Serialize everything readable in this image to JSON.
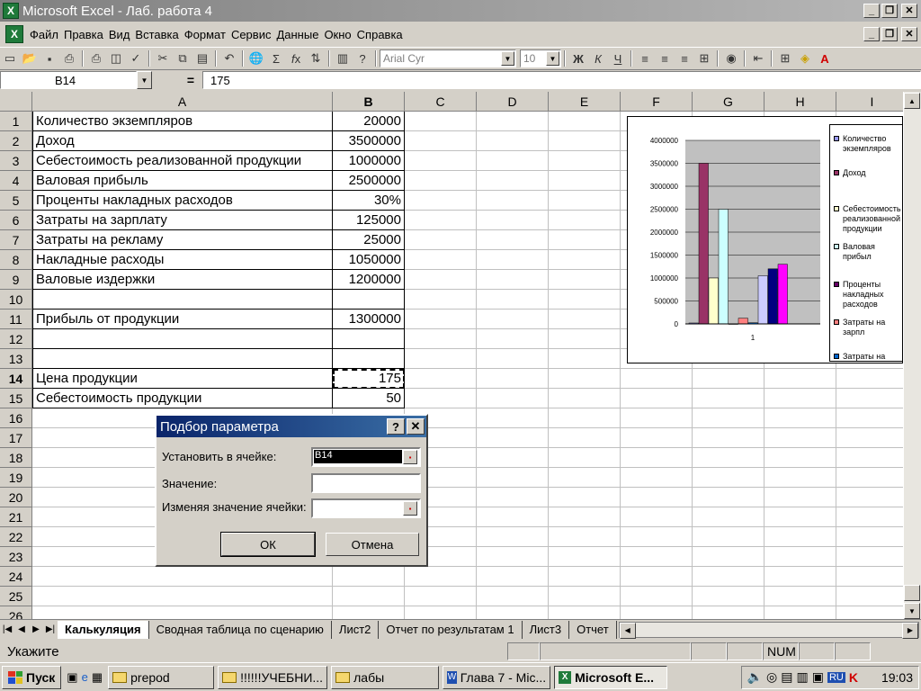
{
  "window": {
    "title": "Microsoft Excel - Лаб. работа 4",
    "app_icon": "X"
  },
  "menu": [
    "Файл",
    "Правка",
    "Вид",
    "Вставка",
    "Формат",
    "Сервис",
    "Данные",
    "Окно",
    "Справка"
  ],
  "toolbar": {
    "font": "Arial Cyr",
    "size": "10",
    "bold": "Ж",
    "italic": "К",
    "underline": "Ч"
  },
  "formula_bar": {
    "name_box": "B14",
    "eq": "=",
    "value": "175"
  },
  "columns": [
    "A",
    "B",
    "C",
    "D",
    "E",
    "F",
    "G",
    "H",
    "I"
  ],
  "rows": [
    {
      "n": "1",
      "a": "Количество экземпляров",
      "b": "20000"
    },
    {
      "n": "2",
      "a": "Доход",
      "b": "3500000"
    },
    {
      "n": "3",
      "a": "Себестоимость реализованной продукции",
      "b": "1000000"
    },
    {
      "n": "4",
      "a": "Валовая прибыль",
      "b": "2500000"
    },
    {
      "n": "5",
      "a": "Проценты накладных расходов",
      "b": "30%"
    },
    {
      "n": "6",
      "a": "Затраты на зарплату",
      "b": "125000"
    },
    {
      "n": "7",
      "a": "Затраты на рекламу",
      "b": "25000"
    },
    {
      "n": "8",
      "a": "Накладные расходы",
      "b": "1050000"
    },
    {
      "n": "9",
      "a": "Валовые издержки",
      "b": "1200000"
    },
    {
      "n": "10",
      "a": "",
      "b": ""
    },
    {
      "n": "11",
      "a": "Прибыль от продукции",
      "b": "1300000"
    },
    {
      "n": "12",
      "a": "",
      "b": ""
    },
    {
      "n": "13",
      "a": "",
      "b": ""
    },
    {
      "n": "14",
      "a": "Цена продукции",
      "b": "175"
    },
    {
      "n": "15",
      "a": "Себестоимость продукции",
      "b": "50"
    },
    {
      "n": "16",
      "a": "",
      "b": ""
    },
    {
      "n": "17",
      "a": "",
      "b": ""
    },
    {
      "n": "18",
      "a": "",
      "b": ""
    },
    {
      "n": "19",
      "a": "",
      "b": ""
    },
    {
      "n": "20",
      "a": "",
      "b": ""
    },
    {
      "n": "21",
      "a": "",
      "b": ""
    },
    {
      "n": "22",
      "a": "",
      "b": ""
    },
    {
      "n": "23",
      "a": "",
      "b": ""
    },
    {
      "n": "24",
      "a": "",
      "b": ""
    },
    {
      "n": "25",
      "a": "",
      "b": ""
    },
    {
      "n": "26",
      "a": "",
      "b": ""
    }
  ],
  "dialog": {
    "title": "Подбор параметра",
    "help": "?",
    "close": "✕",
    "set_cell_label": "Установить в ячейке:",
    "set_cell_value": "B14",
    "value_label": "Значение:",
    "value_value": "",
    "changing_label": "Изменяя значение ячейки:",
    "changing_value": "",
    "ok": "ОК",
    "cancel": "Отмена"
  },
  "chart_data": {
    "type": "bar",
    "categories": [
      "1"
    ],
    "ylim": [
      0,
      4000000
    ],
    "yticks": [
      "4000000",
      "3500000",
      "3000000",
      "2500000",
      "2000000",
      "1500000",
      "1000000",
      "500000",
      "0"
    ],
    "series": [
      {
        "name": "Количество экземпляров",
        "value": 20000,
        "color": "#9999ff"
      },
      {
        "name": "Доход",
        "value": 3500000,
        "color": "#993366"
      },
      {
        "name": "Себестоимость реализованной продукции",
        "value": 1000000,
        "color": "#ffffcc"
      },
      {
        "name": "Валовая прибыль",
        "value": 2500000,
        "color": "#ccffff"
      },
      {
        "name": "Проценты накладных расходов",
        "value": 0.3,
        "color": "#660066"
      },
      {
        "name": "Затраты на зарплату",
        "value": 125000,
        "color": "#ff8080"
      },
      {
        "name": "Затраты на рекламу",
        "value": 25000,
        "color": "#0066cc"
      },
      {
        "name": "Накладные расходы",
        "value": 1050000,
        "color": "#ccccff"
      },
      {
        "name": "Валовые издержки",
        "value": 1200000,
        "color": "#000080"
      },
      {
        "name": "Прибыль от продукции",
        "value": 1300000,
        "color": "#ff00ff"
      }
    ],
    "legend_visible": [
      "Количество экземпляров",
      "Доход",
      "Себестоимость реализованной продукции",
      "Валовая прибыл",
      "Проценты накладных расходов",
      "Затраты на зарпл",
      "Затраты на рекла"
    ]
  },
  "sheets": [
    "Калькуляция",
    "Сводная таблица по сценарию",
    "Лист2",
    "Отчет по результатам 1",
    "Лист3",
    "Отчет"
  ],
  "status": {
    "mode": "Укажите",
    "num": "NUM"
  },
  "taskbar": {
    "start": "Пуск",
    "tasks": [
      "prepod",
      "!!!!!!УЧЕБНИ...",
      "лабы",
      "Глава 7 - Mic...",
      "Microsoft E..."
    ],
    "lang": "RU",
    "clock": "19:03"
  }
}
